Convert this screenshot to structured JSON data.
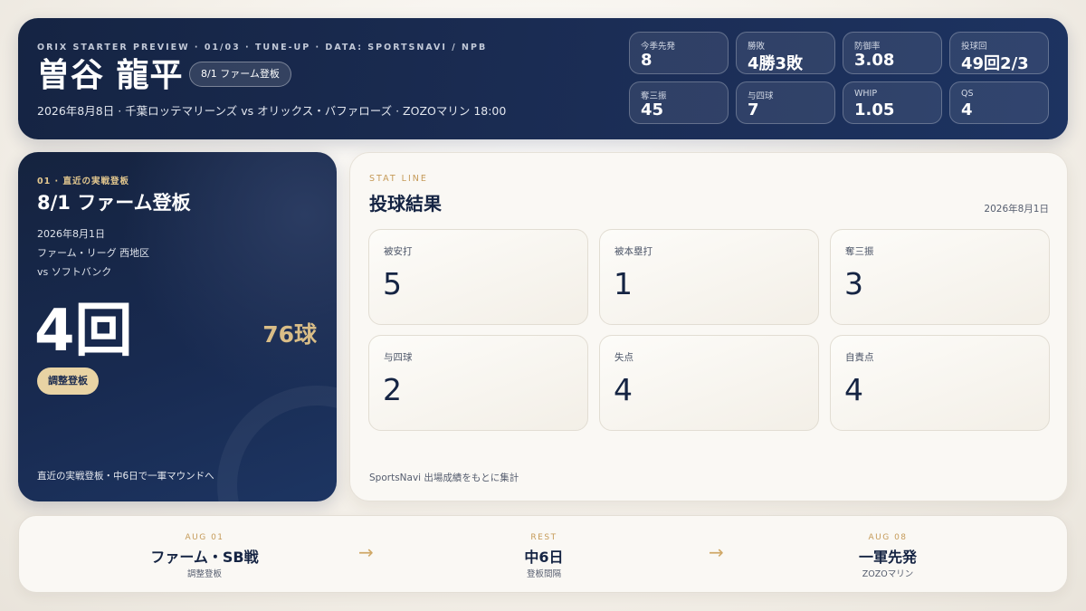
{
  "header": {
    "eyebrow": "ORIX STARTER PREVIEW · 01/03 · TUNE-UP · DATA: SPORTSNAVI / NPB",
    "name": "曽谷 龍平",
    "badge": "8/1 ファーム登板",
    "matchline": "2026年8月8日 · 千葉ロッテマリーンズ vs オリックス・バファローズ · ZOZOマリン 18:00"
  },
  "season_stats": [
    {
      "label": "今季先発",
      "value": "8"
    },
    {
      "label": "勝敗",
      "value": "4勝3敗"
    },
    {
      "label": "防御率",
      "value": "3.08"
    },
    {
      "label": "投球回",
      "value": "49回2/3"
    },
    {
      "label": "奪三振",
      "value": "45"
    },
    {
      "label": "与四球",
      "value": "7"
    },
    {
      "label": "WHIP",
      "value": "1.05"
    },
    {
      "label": "QS",
      "value": "4"
    }
  ],
  "recent": {
    "eyebrow": "01 · 直近の実戦登板",
    "title": "8/1 ファーム登板",
    "date": "2026年8月1日",
    "league": "ファーム・リーグ 西地区",
    "opponent": "vs ソフトバンク",
    "innings": "4回",
    "pitches": "76球",
    "badge": "調整登板",
    "footer": "直近の実戦登板・中6日で一軍マウンドへ"
  },
  "stat_line": {
    "eyebrow": "STAT LINE",
    "title": "投球結果",
    "date": "2026年8月1日",
    "cells": [
      {
        "label": "被安打",
        "value": "5"
      },
      {
        "label": "被本塁打",
        "value": "1"
      },
      {
        "label": "奪三振",
        "value": "3"
      },
      {
        "label": "与四球",
        "value": "2"
      },
      {
        "label": "失点",
        "value": "4"
      },
      {
        "label": "自責点",
        "value": "4"
      }
    ],
    "footer": "SportsNavi 出場成績をもとに集計"
  },
  "timeline": [
    {
      "key": "AUG 01",
      "title": "ファーム・SB戦",
      "sub": "調整登板"
    },
    {
      "key": "REST",
      "title": "中6日",
      "sub": "登板間隔"
    },
    {
      "key": "AUG 08",
      "title": "一軍先発",
      "sub": "ZOZOマリン"
    }
  ],
  "arrows": [
    "→",
    "→"
  ],
  "colors": {
    "navy": "#152443",
    "gold": "#c59a58",
    "badge_gold": "#e8d3a4",
    "cream": "#faf8f4"
  }
}
